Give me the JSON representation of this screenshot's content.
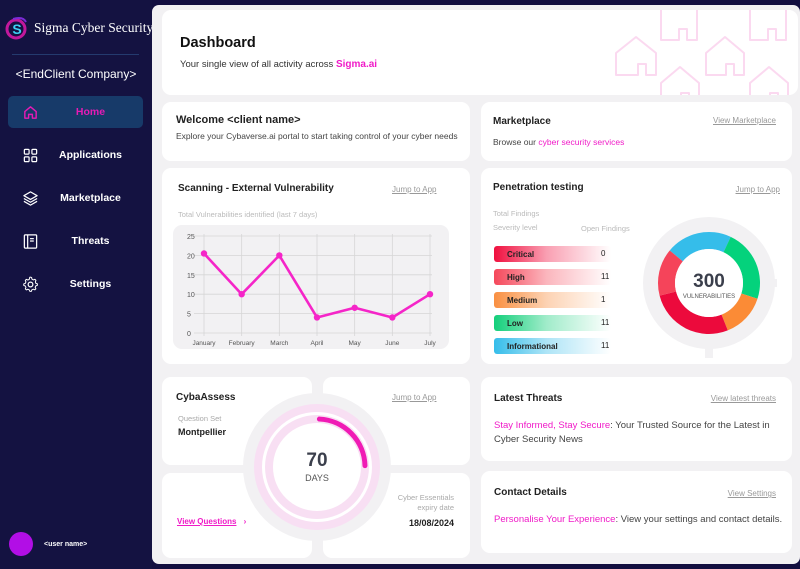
{
  "brand": {
    "name": "Sigma Cyber Security",
    "logo_letter": "S"
  },
  "company": "<EndClient Company>",
  "nav": [
    {
      "label": "Home",
      "icon": "home-icon",
      "active": true
    },
    {
      "label": "Applications",
      "icon": "grid-icon",
      "active": false
    },
    {
      "label": "Marketplace",
      "icon": "layers-icon",
      "active": false
    },
    {
      "label": "Threats",
      "icon": "notebook-icon",
      "active": false
    },
    {
      "label": "Settings",
      "icon": "gear-icon",
      "active": false
    }
  ],
  "user": {
    "name": "<user name>",
    "avatar_color": "#b20ee6"
  },
  "header": {
    "title": "Dashboard",
    "subtitle": "Your single view of all activity across",
    "brand_link": "Sigma.ai"
  },
  "welcome": {
    "title": "Welcome <client name>",
    "text": "Explore your Cybaverse.ai portal to start taking control of your cyber needs"
  },
  "marketplace": {
    "title": "Marketplace",
    "link": "View Marketplace",
    "text_prefix": "Browse our",
    "text_link": "cyber security services"
  },
  "scanning": {
    "title": "Scanning  -  External Vulnerability",
    "link": "Jump to App",
    "subtitle": "Total Vulnerabilities identified (last 7 days)"
  },
  "pentest": {
    "title": "Penetration testing",
    "link": "Jump to App",
    "total_label": "Total Findings",
    "severity_label": "Severity level",
    "open_label": "Open Findings",
    "severities": [
      {
        "label": "Critical",
        "value": "0",
        "color": "#f0103f"
      },
      {
        "label": "High",
        "value": "11",
        "color": "#f5485b"
      },
      {
        "label": "Medium",
        "value": "1",
        "color": "#f99042"
      },
      {
        "label": "Low",
        "value": "11",
        "color": "#14cf7b"
      },
      {
        "label": "Informational",
        "value": "11",
        "color": "#35bdea"
      }
    ],
    "donut": {
      "total": "300",
      "label": "VULNERABILITIES"
    }
  },
  "cybaassess": {
    "title": "CybaAssess",
    "link": "Jump to App",
    "question_set_label": "Question Set",
    "question_set_value": "Montpellier",
    "days_value": "70",
    "days_label": "DAYS",
    "progress_fraction": 0.19,
    "view_questions": "View Questions",
    "expiry_label_1": "Cyber Essentials",
    "expiry_label_2": "expiry date",
    "expiry_date": "18/08/2024"
  },
  "latest_threats": {
    "title": "Latest Threats",
    "link": "View latest threats",
    "highlight": "Stay Informed, Stay Secure",
    "text": ": Your Trusted Source for the Latest in Cyber Security News"
  },
  "contact": {
    "title": "Contact Details",
    "link": "View Settings",
    "highlight": "Personalise Your Experience",
    "text": ": View your settings and contact details."
  },
  "chart_data": [
    {
      "type": "line",
      "title": "Total Vulnerabilities identified (last 7 days)",
      "categories": [
        "January",
        "February",
        "March",
        "April",
        "May",
        "June",
        "July"
      ],
      "values": [
        20.5,
        10,
        20,
        4,
        6.5,
        4,
        10
      ],
      "xlabel": "",
      "ylabel": "",
      "ylim": [
        0,
        25
      ],
      "yticks": [
        0,
        5,
        10,
        15,
        20,
        25
      ],
      "grid": true,
      "color": "#f525c8"
    },
    {
      "type": "pie",
      "title": "Penetration testing",
      "center_label": "300 VULNERABILITIES",
      "labels": [
        "Informational",
        "Low",
        "Medium",
        "Critical",
        "High"
      ],
      "values": [
        21,
        23,
        14,
        27,
        15
      ],
      "colors": [
        "#35bdea",
        "#04d27c",
        "#fb8b36",
        "#ec0a3c",
        "#f5445a"
      ],
      "unit": "percent (estimated)"
    }
  ]
}
